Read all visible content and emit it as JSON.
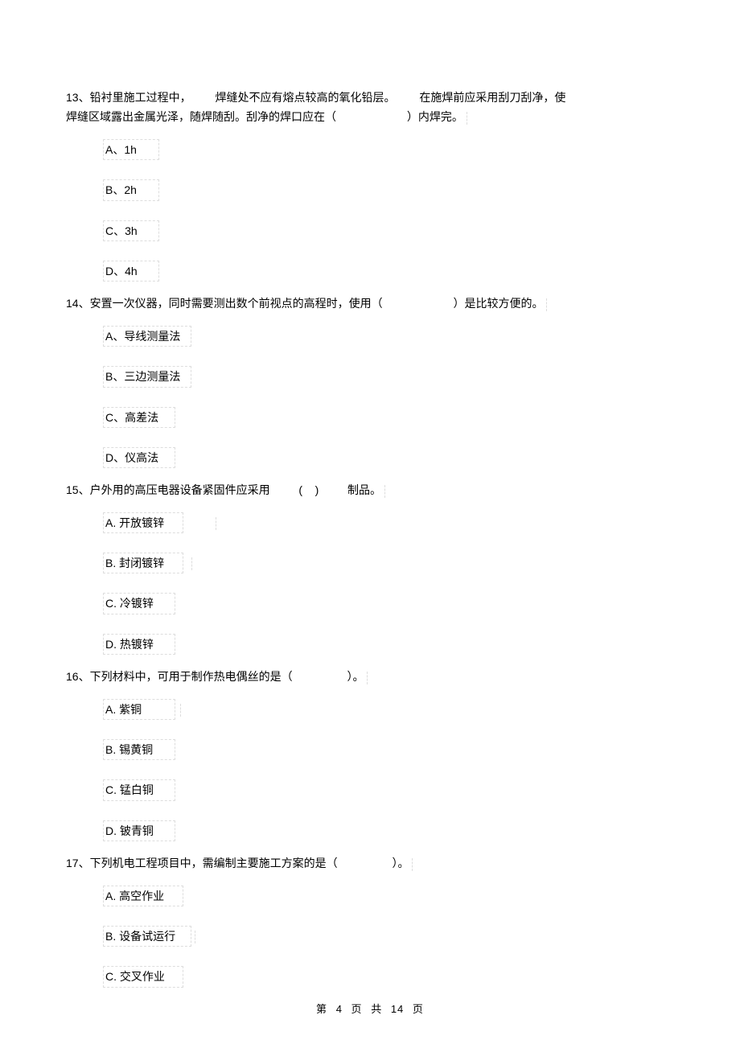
{
  "footer": {
    "prefix": "第",
    "page": "4",
    "middle1": "页",
    "middle2": "共",
    "total": "14",
    "suffix": "页"
  },
  "questions": [
    {
      "num": "13",
      "stem_parts": [
        "13、铅衬里施工过程中，",
        "焊缝处不应有熔点较高的氧化铅层。",
        "在施焊前应采用刮刀刮净，使",
        "焊缝区域露出金属光泽，随焊随刮。刮净的焊口应在（",
        "）内焊完。"
      ],
      "options": [
        "A、1h",
        "B、2h",
        "C、3h",
        "D、4h"
      ]
    },
    {
      "num": "14",
      "stem_parts": [
        "14、安置一次仪器，同时需要测出数个前视点的高程时，使用（",
        "）是比较方便的。"
      ],
      "options": [
        "A、导线测量法",
        "B、三边测量法",
        "C、高差法",
        "D、仪高法"
      ]
    },
    {
      "num": "15",
      "stem_parts": [
        "15、户外用的高压电器设备紧固件应采用",
        "(    )",
        "制品。"
      ],
      "options": [
        "A. 开放镀锌",
        "B. 封闭镀锌",
        "C. 冷镀锌",
        "D. 热镀锌"
      ]
    },
    {
      "num": "16",
      "stem_parts": [
        "16、下列材料中，可用于制作热电偶丝的是（",
        "）。"
      ],
      "options": [
        "A. 紫铜",
        "B. 锡黄铜",
        "C. 锰白铜",
        "D. 铍青铜"
      ]
    },
    {
      "num": "17",
      "stem_parts": [
        "17、下列机电工程项目中，需编制主要施工方案的是（",
        "）。"
      ],
      "options": [
        "A. 高空作业",
        "B. 设备试运行",
        "C. 交叉作业"
      ]
    }
  ]
}
